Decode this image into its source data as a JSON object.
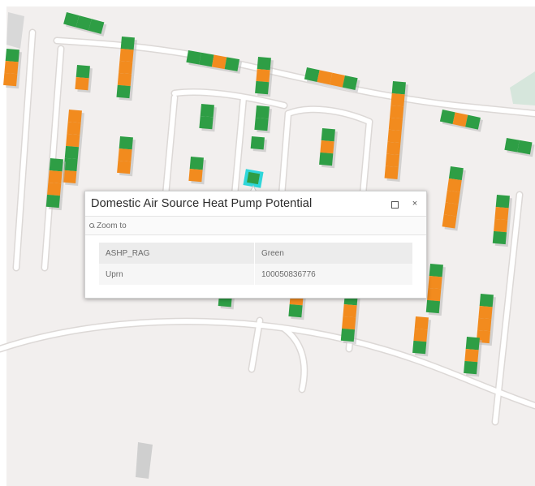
{
  "map": {
    "colors": {
      "background": "#f2efee",
      "road": "#ffffff",
      "road_edge": "#dcd8d6",
      "green": "#2e9e45",
      "orange": "#f28b1e",
      "shadow": "#b8b8b8",
      "park": "#d6e6dc",
      "selection": "#2fd6d9"
    },
    "selected_feature": "building-highlight"
  },
  "popup": {
    "title": "Domestic Air Source Heat Pump Potential",
    "zoom_to_label": "Zoom to",
    "dock_icon": "dock-icon",
    "close_icon": "close-icon",
    "close_glyph": "×",
    "attributes": [
      {
        "field": "ASHP_RAG",
        "value": "Green"
      },
      {
        "field": "Uprn",
        "value": "100050836776"
      }
    ]
  }
}
